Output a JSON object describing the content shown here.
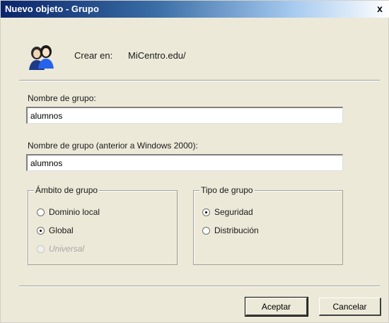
{
  "window": {
    "title": "Nuevo objeto - Grupo",
    "close_glyph": "x"
  },
  "header": {
    "icon": "users-group-icon",
    "create_in_label": "Crear en:",
    "create_in_value": "MiCentro.edu/"
  },
  "form": {
    "group_name_label": "Nombre de grupo:",
    "group_name_value": "alumnos",
    "group_name_pre2000_label": "Nombre de grupo (anterior a Windows 2000):",
    "group_name_pre2000_value": "alumnos"
  },
  "scope": {
    "title": "Ámbito de grupo",
    "options": [
      {
        "label": "Dominio local",
        "checked": false,
        "disabled": false
      },
      {
        "label": "Global",
        "checked": true,
        "disabled": false
      },
      {
        "label": "Universal",
        "checked": false,
        "disabled": true
      }
    ]
  },
  "type": {
    "title": "Tipo de grupo",
    "options": [
      {
        "label": "Seguridad",
        "checked": true,
        "disabled": false
      },
      {
        "label": "Distribución",
        "checked": false,
        "disabled": false
      }
    ]
  },
  "buttons": {
    "ok_label": "Aceptar",
    "cancel_label": "Cancelar"
  },
  "colors": {
    "titlebar_start": "#0a246a",
    "dialog_background": "#ece9d8"
  }
}
